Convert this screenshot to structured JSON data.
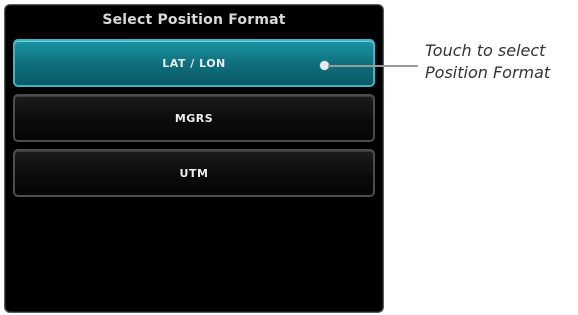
{
  "dialog": {
    "title": "Select Position Format",
    "options": [
      {
        "label": "LAT / LON",
        "selected": true
      },
      {
        "label": "MGRS",
        "selected": false
      },
      {
        "label": "UTM",
        "selected": false
      }
    ]
  },
  "callout": {
    "line1": "Touch to select",
    "line2": "Position Format"
  },
  "colors": {
    "selected_fill": "#0e6d7a",
    "selected_border": "#3fb5c4",
    "panel_background": "#000000"
  }
}
